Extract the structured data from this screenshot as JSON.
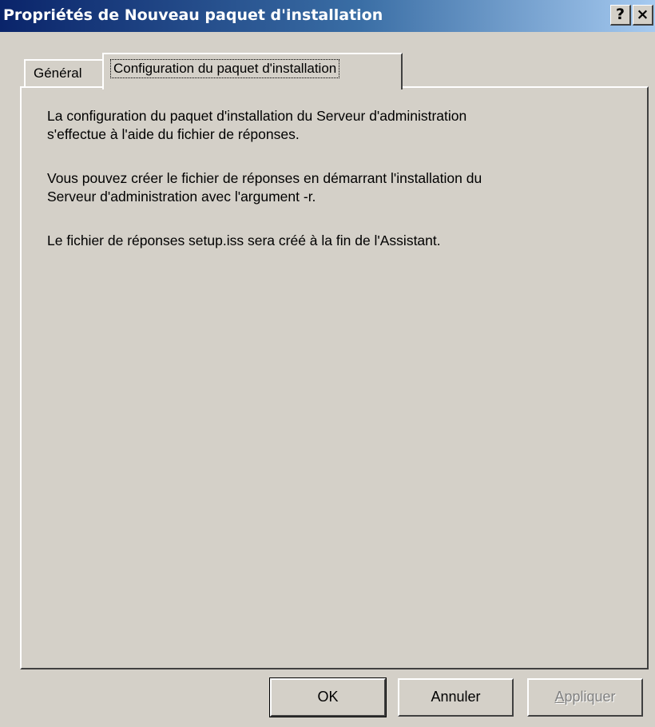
{
  "window": {
    "title": "Propriétés de Nouveau paquet d'installation",
    "help_button": "?",
    "close_button": "×"
  },
  "tabs": [
    {
      "label": "Général",
      "active": false
    },
    {
      "label": "Configuration du paquet d'installation",
      "active": true
    }
  ],
  "content": {
    "paragraphs": [
      "La configuration du paquet d'installation du Serveur d'administration\ns'effectue à l'aide du fichier de réponses.",
      "Vous pouvez créer le fichier de réponses en démarrant l'installation du\nServeur d'administration avec l'argument -r.",
      "Le fichier de réponses setup.iss sera créé à la fin de l'Assistant."
    ]
  },
  "buttons": {
    "ok": "OK",
    "cancel": "Annuler",
    "apply_mnemonic": "A",
    "apply_rest": "ppliquer",
    "apply_enabled": false
  },
  "colors": {
    "face": "#d4d0c8",
    "title_start": "#0a246a",
    "title_end": "#a6caf0"
  }
}
